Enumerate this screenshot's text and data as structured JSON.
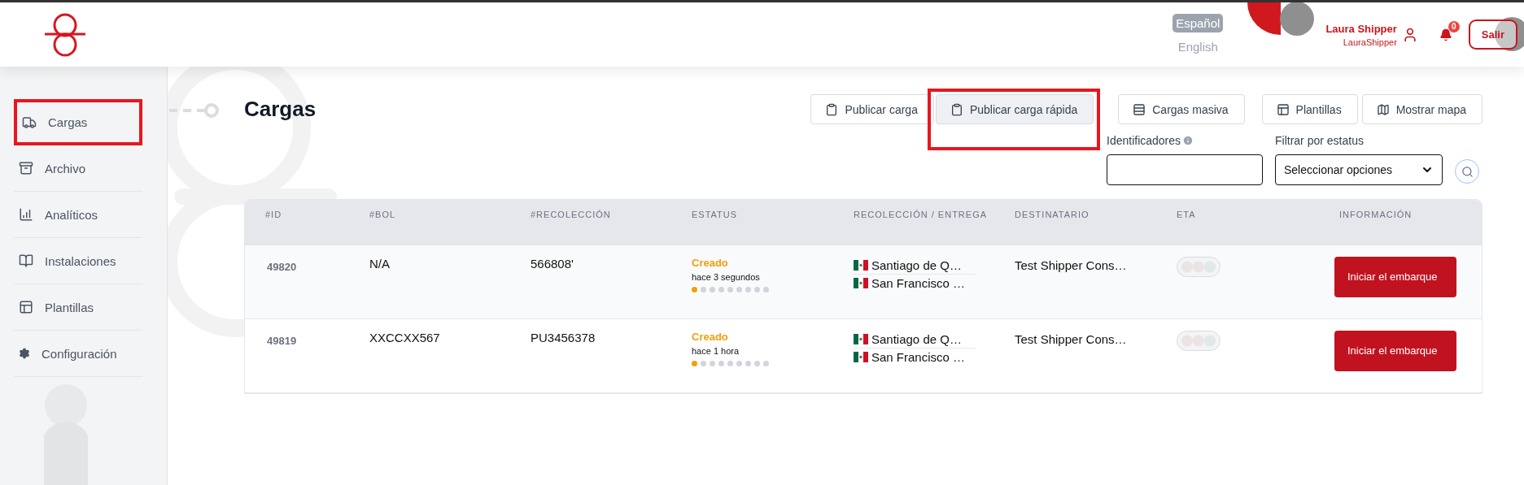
{
  "header": {
    "languages": [
      {
        "label": "Español",
        "selected": true
      },
      {
        "label": "English",
        "selected": false
      }
    ],
    "user": {
      "name": "Laura Shipper",
      "username": "LauraShipper"
    },
    "notifications": {
      "count": "0"
    },
    "logout": "Salir"
  },
  "sidebar": {
    "items": [
      {
        "label": "Cargas",
        "highlighted": true
      },
      {
        "label": "Archivo",
        "highlighted": false
      },
      {
        "label": "Analíticos",
        "highlighted": false
      },
      {
        "label": "Instalaciones",
        "highlighted": false
      },
      {
        "label": "Plantillas",
        "highlighted": false
      },
      {
        "label": "Configuración",
        "highlighted": false
      }
    ]
  },
  "page": {
    "title": "Cargas"
  },
  "toolbar": [
    {
      "label": "Publicar carga",
      "active": false,
      "highlighted": false
    },
    {
      "label": "Publicar carga rápida",
      "active": true,
      "highlighted": true
    },
    {
      "label": "Cargas masiva",
      "active": false,
      "highlighted": false
    },
    {
      "label": "Plantillas",
      "active": false,
      "highlighted": false
    },
    {
      "label": "Mostrar mapa",
      "active": false,
      "highlighted": false
    }
  ],
  "filters": {
    "identifiers_label": "Identificadores",
    "status_label": "Filtrar por estatus",
    "status_value": "Seleccionar opciones"
  },
  "table": {
    "columns": [
      "#ID",
      "#BOL",
      "#RECOLECCIÓN",
      "ESTATUS",
      "RECOLECCIÓN / ENTREGA",
      "DESTINATARIO",
      "ETA",
      "INFORMACIÓN"
    ],
    "rows": [
      {
        "id": "49820",
        "bol": "N/A",
        "pickup_number": "566808'",
        "status": "Creado",
        "time": "hace 3 segundos",
        "steps": [
          {
            "done": true
          },
          {
            "done": false
          },
          {
            "done": false
          },
          {
            "done": false
          },
          {
            "done": false
          },
          {
            "done": false
          },
          {
            "done": false
          },
          {
            "done": false
          },
          {
            "done": false
          }
        ],
        "origin": "Santiago de Q…",
        "destination": "San Francisco …",
        "recipient": "Test Shipper Cons…",
        "action": "Iniciar el embarque"
      },
      {
        "id": "49819",
        "bol": "XXCCXX567",
        "pickup_number": "PU3456378",
        "status": "Creado",
        "time": "hace 1 hora",
        "steps": [
          {
            "done": true
          },
          {
            "done": false
          },
          {
            "done": false
          },
          {
            "done": false
          },
          {
            "done": false
          },
          {
            "done": false
          },
          {
            "done": false
          },
          {
            "done": false
          },
          {
            "done": false
          }
        ],
        "origin": "Santiago de Q…",
        "destination": "San Francisco …",
        "recipient": "Test Shipper Cons…",
        "action": "Iniciar el embarque"
      }
    ]
  }
}
